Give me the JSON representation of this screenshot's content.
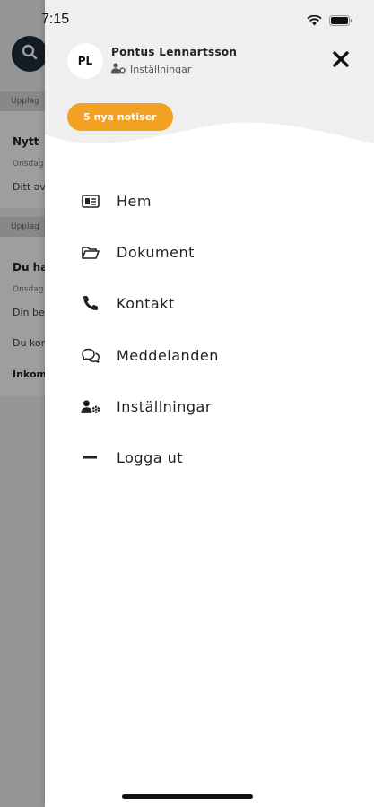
{
  "status_bar": {
    "time": "7:15"
  },
  "background": {
    "separators": [
      "Upplag",
      "Upplag"
    ],
    "cards": [
      {
        "title": "Nytt",
        "date": "Onsdag",
        "text": "Ditt av"
      },
      {
        "title": "Du ha",
        "date": "Onsdag",
        "text": "Din be",
        "text2": "Du kor",
        "text3": "Inkom"
      }
    ]
  },
  "drawer": {
    "user": {
      "initials": "PL",
      "name": "Pontus Lennartsson",
      "settings_label": "Inställningar"
    },
    "notice_label": "5 nya notiser",
    "menu": [
      {
        "label": "Hem",
        "icon": "home-card-icon"
      },
      {
        "label": "Dokument",
        "icon": "folder-icon"
      },
      {
        "label": "Kontakt",
        "icon": "phone-icon"
      },
      {
        "label": "Meddelanden",
        "icon": "chat-icon"
      },
      {
        "label": "Inställningar",
        "icon": "user-settings-icon"
      },
      {
        "label": "Logga ut",
        "icon": "minus-icon"
      }
    ]
  },
  "colors": {
    "accent": "#f2a123",
    "header_bg": "#efefef",
    "dark_button": "#1f2d3f"
  }
}
